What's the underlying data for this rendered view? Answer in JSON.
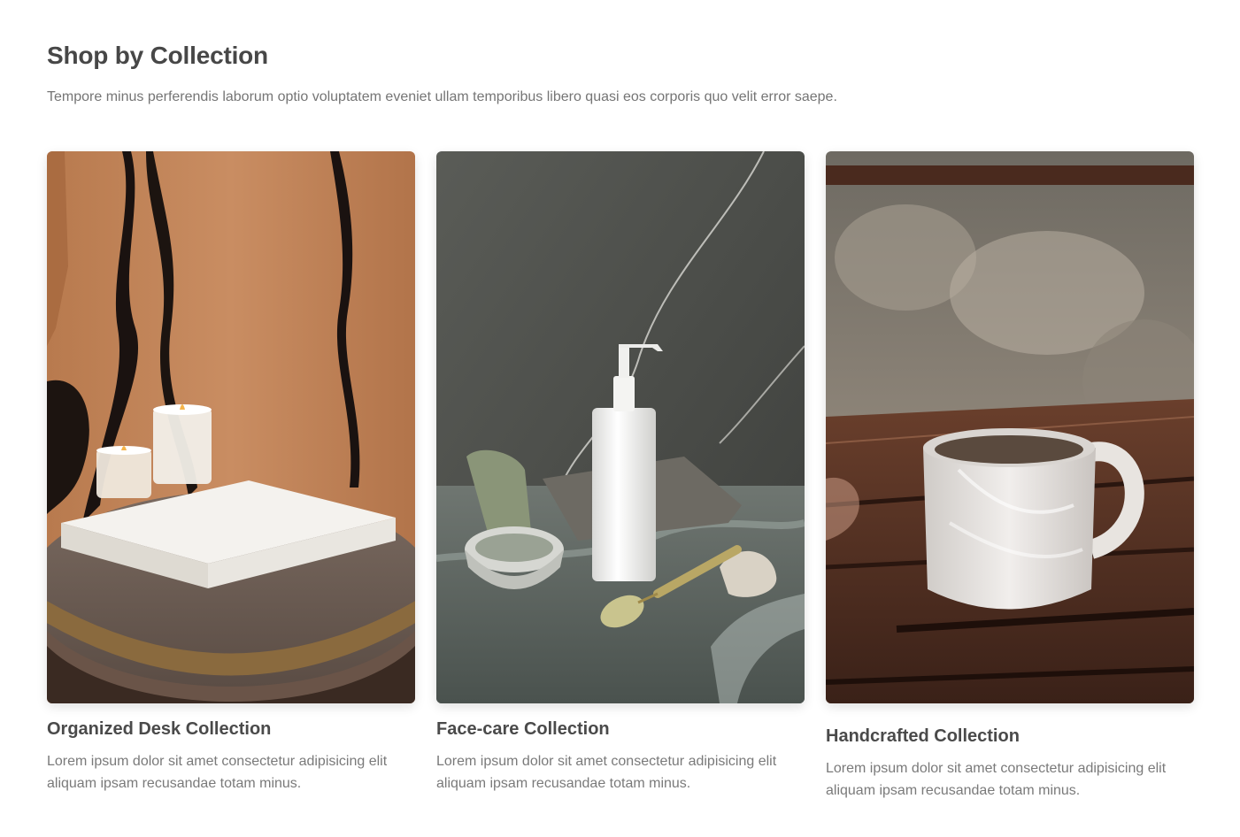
{
  "section": {
    "title": "Shop by Collection",
    "subtitle": "Tempore minus perferendis laborum optio voluptatem eveniet ullam temporibus libero quasi eos corporis quo velit error saepe."
  },
  "collections": [
    {
      "title": "Organized Desk Collection",
      "description": "Lorem ipsum dolor sit amet consectetur adipisicing elit aliquam ipsam recusandae totam minus.",
      "image_icon": "desk-candles-book-photo"
    },
    {
      "title": "Face-care Collection",
      "description": "Lorem ipsum dolor sit amet consectetur adipisicing elit aliquam ipsam recusandae totam minus.",
      "image_icon": "skincare-bottle-roller-photo"
    },
    {
      "title": "Handcrafted Collection",
      "description": "Lorem ipsum dolor sit amet consectetur adipisicing elit aliquam ipsam recusandae totam minus.",
      "image_icon": "ceramic-mug-photo"
    }
  ]
}
